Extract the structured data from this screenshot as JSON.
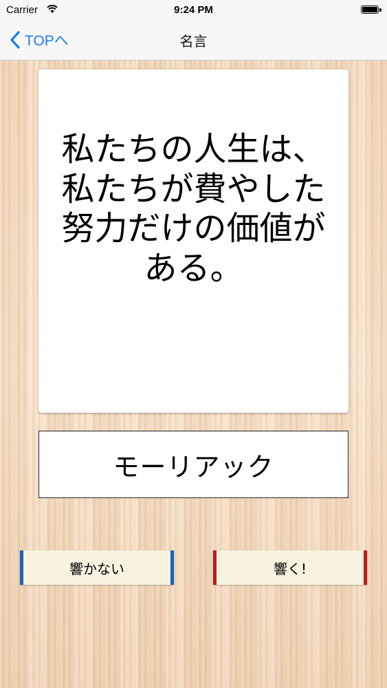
{
  "status_bar": {
    "carrier": "Carrier",
    "time": "9:24 PM",
    "wifi_icon": "wifi-icon",
    "battery_icon": "battery-icon",
    "battery_level": 1.0
  },
  "nav": {
    "back_label": "TOPへ",
    "back_icon": "chevron-left-icon",
    "title": "名言",
    "accent_color": "#1a7cf5"
  },
  "quote": {
    "text": "私たちの人生は、私たちが費やした努力だけの価値がある。",
    "author": "モーリアック"
  },
  "buttons": {
    "left_label": "響かない",
    "left_color": "#1a63b8",
    "right_label": "響く!",
    "right_color": "#c41a1a"
  }
}
